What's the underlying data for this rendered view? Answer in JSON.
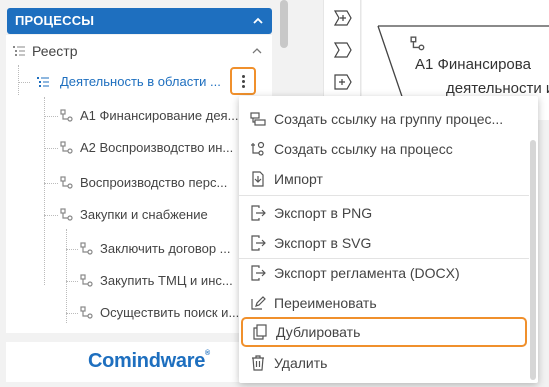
{
  "sidebar": {
    "section_title": "ПРОЦЕССЫ",
    "tree": {
      "root_label": "Реестр",
      "selected_label": "Деятельность в области ...",
      "items": [
        "А1 Финансирование дея...",
        "А2 Воспроизводство ин...",
        "Воспроизводство перс...",
        "Закупки и снабжение"
      ],
      "sub_items": [
        "Заключить договор ...",
        "Закупить ТМЦ и инс...",
        "Осуществить поиск и..."
      ]
    },
    "logo_text": "Comindware",
    "logo_mark": "®"
  },
  "canvas": {
    "line1": "А1 Финансирова",
    "line2": "деятельности и"
  },
  "context_menu": {
    "items": [
      {
        "label": "Создать ссылку на группу процес...",
        "icon": "link-group-icon"
      },
      {
        "label": "Создать ссылку на процесс",
        "icon": "link-process-icon"
      },
      {
        "label": "Импорт",
        "icon": "import-icon"
      },
      {
        "label": "Экспорт в PNG",
        "icon": "export-icon"
      },
      {
        "label": "Экспорт в SVG",
        "icon": "export-icon"
      },
      {
        "label": "Экспорт регламента (DOCX)",
        "icon": "export-icon"
      },
      {
        "label": "Переименовать",
        "icon": "rename-icon"
      },
      {
        "label": "Дублировать",
        "icon": "duplicate-icon"
      },
      {
        "label": "Удалить",
        "icon": "delete-icon"
      }
    ]
  },
  "colors": {
    "accent": "#1e6fbf",
    "highlight": "#f0902c"
  }
}
